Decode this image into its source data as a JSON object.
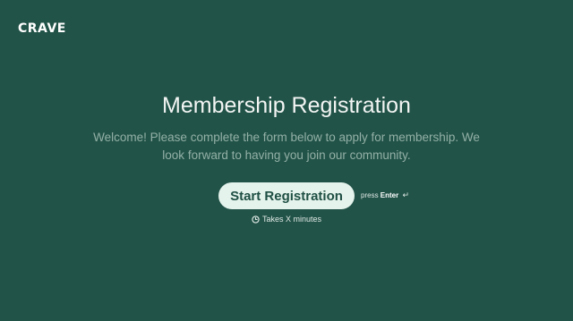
{
  "brand": {
    "logo_text": "CRAVE"
  },
  "main": {
    "title": "Membership Registration",
    "description": "Welcome! Please complete the form below to apply for membership. We look forward to having you join our community.",
    "start_button_label": "Start Registration",
    "hint_prefix": "press",
    "hint_key": "Enter",
    "hint_icon": "↵",
    "duration_text": "Takes X minutes",
    "duration_icon": "clock-icon"
  },
  "colors": {
    "background": "#225348",
    "button_background": "#e4f3ec",
    "button_text": "#1f4f43",
    "description_text": "#93b0a6"
  }
}
